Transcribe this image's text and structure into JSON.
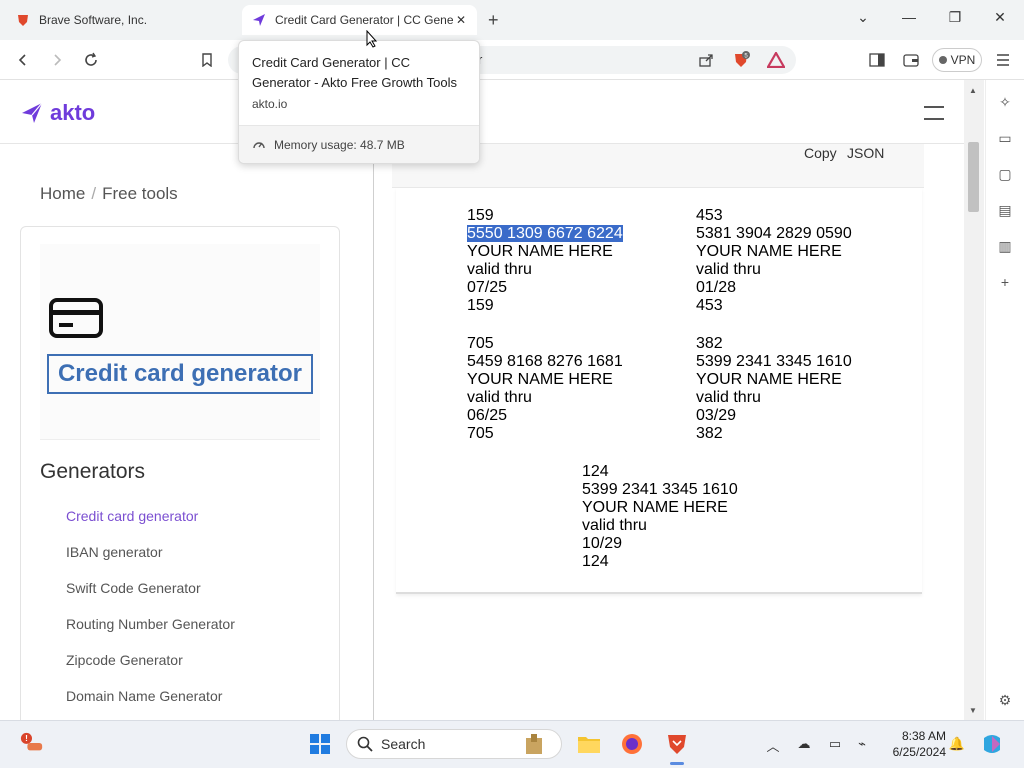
{
  "browser": {
    "tabs": [
      {
        "title": "Brave Software, Inc.",
        "active": false
      },
      {
        "title": "Credit Card Generator | CC Generator - Akto Free Growth Tools",
        "active": true
      }
    ],
    "address": "r",
    "vpn_label": "VPN",
    "shield_count": "5"
  },
  "tooltip": {
    "title": "Credit Card Generator | CC Generator - Akto Free Growth Tools",
    "domain": "akto.io",
    "memory": "Memory usage: 48.7 MB"
  },
  "site": {
    "logo_text": "akto",
    "brand_color": "#6f3bdb"
  },
  "sidebar": {
    "breadcrumb": {
      "home": "Home",
      "sep": "/",
      "current": "Free tools"
    },
    "tool_title": "Credit card generator",
    "generators_heading": "Generators",
    "links": [
      {
        "label": "Credit card generator",
        "active": true
      },
      {
        "label": "IBAN generator",
        "active": false
      },
      {
        "label": "Swift Code Generator",
        "active": false
      },
      {
        "label": "Routing Number Generator",
        "active": false
      },
      {
        "label": "Zipcode Generator",
        "active": false
      },
      {
        "label": "Domain Name Generator",
        "active": false
      }
    ]
  },
  "results": {
    "actions": {
      "copy": "Copy",
      "json": "JSON"
    },
    "cards": [
      {
        "cvv": "159",
        "number": "5550 1309 6672 6224",
        "name": "YOUR NAME HERE",
        "valid_label": "valid thru",
        "expiry": "07/25",
        "cvv2": "159",
        "selected": true
      },
      {
        "cvv": "453",
        "number": "5381 3904 2829 0590",
        "name": "YOUR NAME HERE",
        "valid_label": "valid thru",
        "expiry": "01/28",
        "cvv2": "453",
        "selected": false
      },
      {
        "cvv": "705",
        "number": "5459 8168 8276 1681",
        "name": "YOUR NAME HERE",
        "valid_label": "valid thru",
        "expiry": "06/25",
        "cvv2": "705",
        "selected": false
      },
      {
        "cvv": "382",
        "number": "5399 2341 3345 1610",
        "name": "YOUR NAME HERE",
        "valid_label": "valid thru",
        "expiry": "03/29",
        "cvv2": "382",
        "selected": false
      },
      {
        "cvv": "124",
        "number": "5399 2341 3345 1610",
        "name": "YOUR NAME HERE",
        "valid_label": "valid thru",
        "expiry": "10/29",
        "cvv2": "124",
        "selected": false
      }
    ]
  },
  "taskbar": {
    "search_label": "Search",
    "time": "8:38 AM",
    "date": "6/25/2024"
  }
}
